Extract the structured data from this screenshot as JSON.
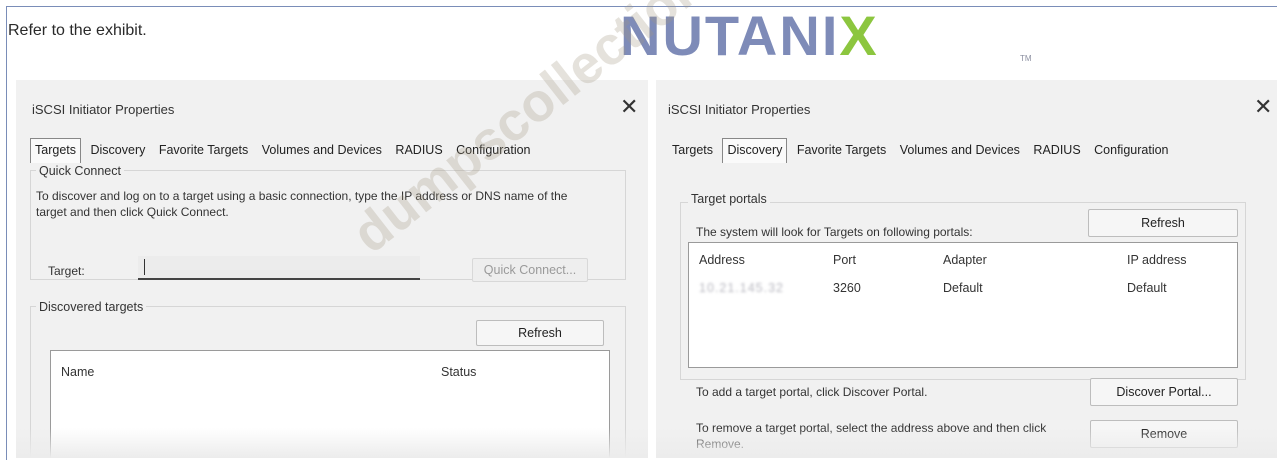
{
  "header": {
    "intro_text": "Refer to the exhibit.",
    "logo_text": "NUTANIX",
    "logo_tm": "TM",
    "watermark": "dumpscollection.com",
    "colors": {
      "logo": "#7e8bb8",
      "logo_x_accent": "#8cc63f"
    }
  },
  "left_window": {
    "title": "iSCSI Initiator Properties",
    "close_glyph": "✕",
    "tabs": [
      "Targets",
      "Discovery",
      "Favorite Targets",
      "Volumes and Devices",
      "RADIUS",
      "Configuration"
    ],
    "active_tab": "Targets",
    "quick_connect": {
      "group_label": "Quick Connect",
      "description": "To discover and log on to a target using a basic connection, type the IP address or DNS name of the target and then click Quick Connect.",
      "target_label": "Target:",
      "target_value": "",
      "quick_connect_button": "Quick Connect..."
    },
    "discovered_targets": {
      "group_label": "Discovered targets",
      "refresh_button": "Refresh",
      "columns": [
        "Name",
        "Status"
      ]
    }
  },
  "right_window": {
    "title": "iSCSI Initiator Properties",
    "close_glyph": "✕",
    "tabs": [
      "Targets",
      "Discovery",
      "Favorite Targets",
      "Volumes and Devices",
      "RADIUS",
      "Configuration"
    ],
    "active_tab": "Discovery",
    "target_portals": {
      "group_label": "Target portals",
      "description": "The system will look for Targets on following portals:",
      "refresh_button": "Refresh",
      "columns": [
        "Address",
        "Port",
        "Adapter",
        "IP address"
      ],
      "rows": [
        {
          "address": "10.21.145.32",
          "port": "3260",
          "adapter": "Default",
          "ip_address": "Default"
        }
      ]
    },
    "discover_text": "To add a target portal, click Discover Portal.",
    "discover_button": "Discover Portal...",
    "remove_text": "To remove a target portal, select the address above and then click Remove.",
    "remove_button": "Remove"
  }
}
